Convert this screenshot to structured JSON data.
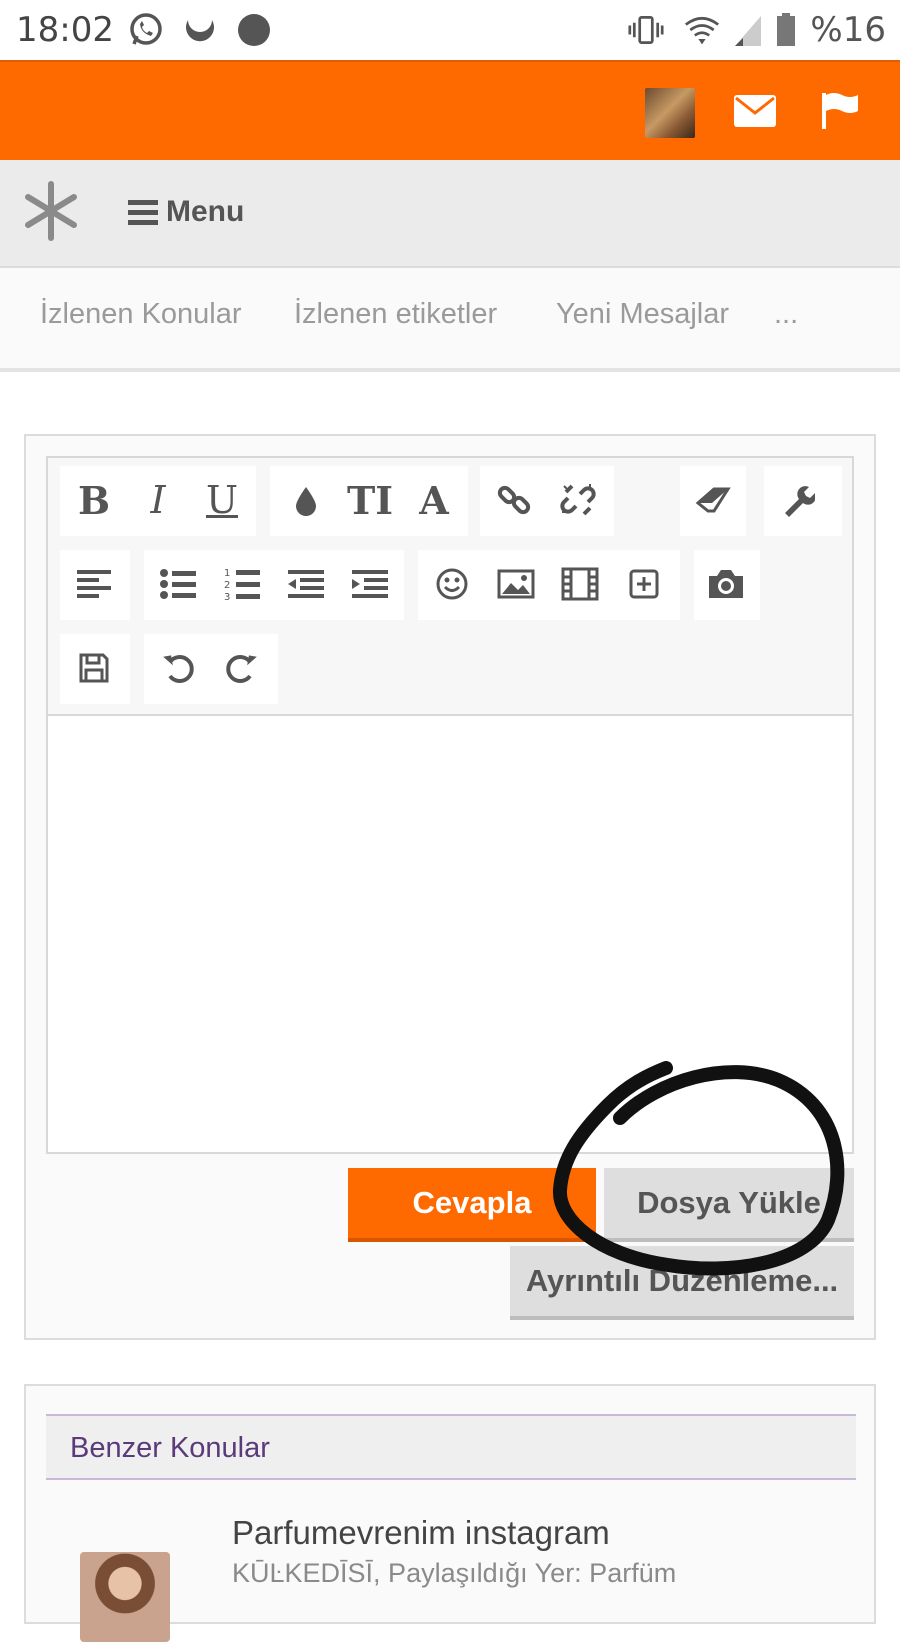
{
  "status_bar": {
    "time": "18:02",
    "icons": [
      "whatsapp-icon",
      "moon-icon",
      "dot-icon",
      "vibrate-icon",
      "wifi-icon",
      "signal-icon",
      "battery-icon"
    ],
    "battery_text": "%16"
  },
  "header": {
    "icons": [
      "avatar",
      "mail-icon",
      "flag-icon"
    ],
    "accent_color": "#ff6a00"
  },
  "nav": {
    "menu_label": "Menu"
  },
  "tabs": [
    {
      "label": "İzlenen Konular"
    },
    {
      "label": "İzlenen etiketler"
    },
    {
      "label": "Yeni Mesajlar"
    },
    {
      "label": "..."
    }
  ],
  "editor": {
    "toolbar_row1": [
      "B",
      "I",
      "U",
      "color-icon",
      "TI",
      "A",
      "link-icon",
      "unlink-icon",
      "eraser-icon",
      "wrench-icon"
    ],
    "toolbar_row2": [
      "align-left-icon",
      "bullet-list-icon",
      "numbered-list-icon",
      "outdent-icon",
      "indent-icon",
      "smiley-icon",
      "image-icon",
      "media-icon",
      "insert-icon",
      "camera-icon"
    ],
    "toolbar_row3": [
      "save-icon",
      "undo-icon",
      "redo-icon"
    ],
    "value": ""
  },
  "actions": {
    "reply_label": "Cevapla",
    "upload_label": "Dosya Yükle",
    "advanced_label": "Ayrıntılı Düzenleme..."
  },
  "similar": {
    "title": "Benzer Konular",
    "threads": [
      {
        "title": "Parfumevrenim instagram",
        "meta": "ΚŪĿΚΕDĪSĪ, Paylaşıldığı Yer: Parfüm"
      }
    ]
  }
}
